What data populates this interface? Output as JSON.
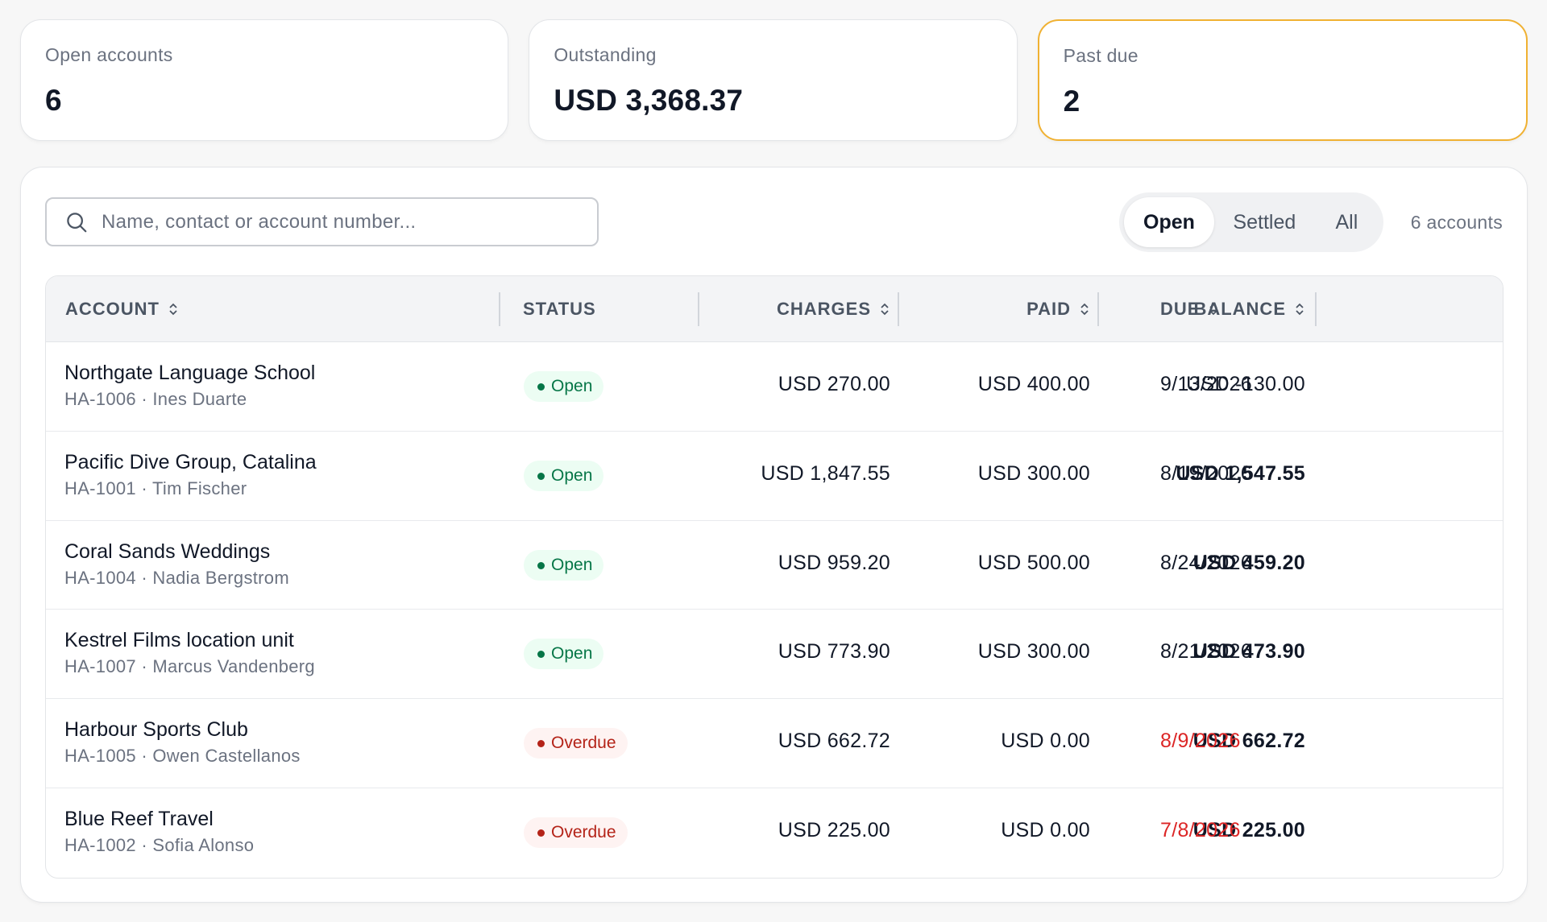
{
  "summary": {
    "open_accounts": {
      "label": "Open accounts",
      "value": "6"
    },
    "outstanding": {
      "label": "Outstanding",
      "value": "USD 3,368.37"
    },
    "past_due": {
      "label": "Past due",
      "value": "2"
    }
  },
  "search": {
    "placeholder": "Name, contact or account number...",
    "value": ""
  },
  "filters": {
    "tabs": [
      "Open",
      "Settled",
      "All"
    ],
    "active": "Open"
  },
  "count_label": "6 accounts",
  "columns": {
    "account": "ACCOUNT",
    "status": "STATUS",
    "charges": "CHARGES",
    "paid": "PAID",
    "balance": "BALANCE",
    "due": "DUE"
  },
  "rows": [
    {
      "name": "Northgate Language School",
      "sub": "HA-1006 · Ines Duarte",
      "status": "Open",
      "charges": "USD 270.00",
      "paid": "USD 400.00",
      "balance": "USD -130.00",
      "due": "9/13/2026"
    },
    {
      "name": "Pacific Dive Group, Catalina",
      "sub": "HA-1001 · Tim Fischer",
      "status": "Open",
      "charges": "USD 1,847.55",
      "paid": "USD 300.00",
      "balance": "USD 1,547.55",
      "due": "8/19/2026"
    },
    {
      "name": "Coral Sands Weddings",
      "sub": "HA-1004 · Nadia Bergstrom",
      "status": "Open",
      "charges": "USD 959.20",
      "paid": "USD 500.00",
      "balance": "USD 459.20",
      "due": "8/24/2026"
    },
    {
      "name": "Kestrel Films location unit",
      "sub": "HA-1007 · Marcus Vandenberg",
      "status": "Open",
      "charges": "USD 773.90",
      "paid": "USD 300.00",
      "balance": "USD 473.90",
      "due": "8/21/2026"
    },
    {
      "name": "Harbour Sports Club",
      "sub": "HA-1005 · Owen Castellanos",
      "status": "Overdue",
      "charges": "USD 662.72",
      "paid": "USD 0.00",
      "balance": "USD 662.72",
      "due": "8/9/2026"
    },
    {
      "name": "Blue Reef Travel",
      "sub": "HA-1002 · Sofia Alonso",
      "status": "Overdue",
      "charges": "USD 225.00",
      "paid": "USD 0.00",
      "balance": "USD 225.00",
      "due": "7/8/2026"
    }
  ],
  "colors": {
    "open": "#067647",
    "overdue": "#b42318",
    "due_overdue": "#dc2626",
    "past_due_border": "#f0b132"
  },
  "icons": {
    "search": "search-icon",
    "sort": "sort-icon"
  }
}
